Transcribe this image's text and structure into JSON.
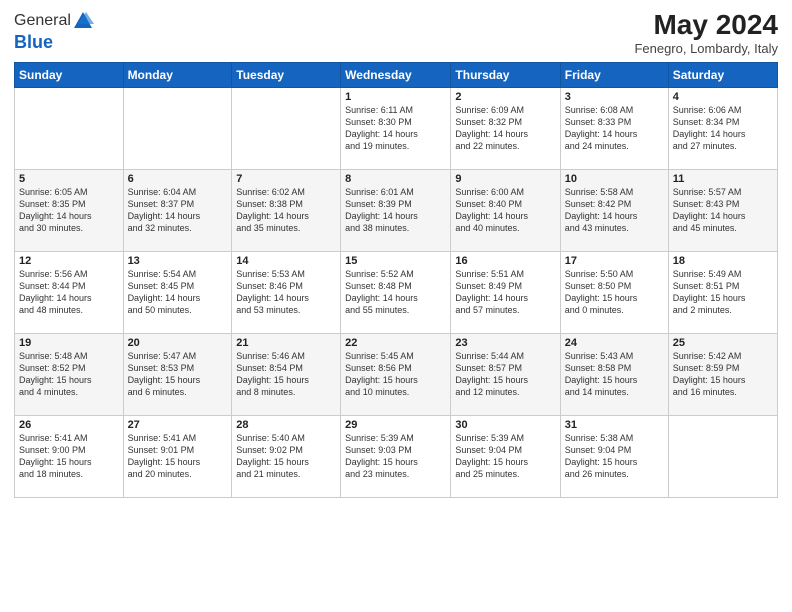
{
  "logo": {
    "general": "General",
    "blue": "Blue"
  },
  "header": {
    "month_year": "May 2024",
    "location": "Fenegro, Lombardy, Italy"
  },
  "weekdays": [
    "Sunday",
    "Monday",
    "Tuesday",
    "Wednesday",
    "Thursday",
    "Friday",
    "Saturday"
  ],
  "weeks": [
    [
      {
        "day": "",
        "info": ""
      },
      {
        "day": "",
        "info": ""
      },
      {
        "day": "",
        "info": ""
      },
      {
        "day": "1",
        "info": "Sunrise: 6:11 AM\nSunset: 8:30 PM\nDaylight: 14 hours\nand 19 minutes."
      },
      {
        "day": "2",
        "info": "Sunrise: 6:09 AM\nSunset: 8:32 PM\nDaylight: 14 hours\nand 22 minutes."
      },
      {
        "day": "3",
        "info": "Sunrise: 6:08 AM\nSunset: 8:33 PM\nDaylight: 14 hours\nand 24 minutes."
      },
      {
        "day": "4",
        "info": "Sunrise: 6:06 AM\nSunset: 8:34 PM\nDaylight: 14 hours\nand 27 minutes."
      }
    ],
    [
      {
        "day": "5",
        "info": "Sunrise: 6:05 AM\nSunset: 8:35 PM\nDaylight: 14 hours\nand 30 minutes."
      },
      {
        "day": "6",
        "info": "Sunrise: 6:04 AM\nSunset: 8:37 PM\nDaylight: 14 hours\nand 32 minutes."
      },
      {
        "day": "7",
        "info": "Sunrise: 6:02 AM\nSunset: 8:38 PM\nDaylight: 14 hours\nand 35 minutes."
      },
      {
        "day": "8",
        "info": "Sunrise: 6:01 AM\nSunset: 8:39 PM\nDaylight: 14 hours\nand 38 minutes."
      },
      {
        "day": "9",
        "info": "Sunrise: 6:00 AM\nSunset: 8:40 PM\nDaylight: 14 hours\nand 40 minutes."
      },
      {
        "day": "10",
        "info": "Sunrise: 5:58 AM\nSunset: 8:42 PM\nDaylight: 14 hours\nand 43 minutes."
      },
      {
        "day": "11",
        "info": "Sunrise: 5:57 AM\nSunset: 8:43 PM\nDaylight: 14 hours\nand 45 minutes."
      }
    ],
    [
      {
        "day": "12",
        "info": "Sunrise: 5:56 AM\nSunset: 8:44 PM\nDaylight: 14 hours\nand 48 minutes."
      },
      {
        "day": "13",
        "info": "Sunrise: 5:54 AM\nSunset: 8:45 PM\nDaylight: 14 hours\nand 50 minutes."
      },
      {
        "day": "14",
        "info": "Sunrise: 5:53 AM\nSunset: 8:46 PM\nDaylight: 14 hours\nand 53 minutes."
      },
      {
        "day": "15",
        "info": "Sunrise: 5:52 AM\nSunset: 8:48 PM\nDaylight: 14 hours\nand 55 minutes."
      },
      {
        "day": "16",
        "info": "Sunrise: 5:51 AM\nSunset: 8:49 PM\nDaylight: 14 hours\nand 57 minutes."
      },
      {
        "day": "17",
        "info": "Sunrise: 5:50 AM\nSunset: 8:50 PM\nDaylight: 15 hours\nand 0 minutes."
      },
      {
        "day": "18",
        "info": "Sunrise: 5:49 AM\nSunset: 8:51 PM\nDaylight: 15 hours\nand 2 minutes."
      }
    ],
    [
      {
        "day": "19",
        "info": "Sunrise: 5:48 AM\nSunset: 8:52 PM\nDaylight: 15 hours\nand 4 minutes."
      },
      {
        "day": "20",
        "info": "Sunrise: 5:47 AM\nSunset: 8:53 PM\nDaylight: 15 hours\nand 6 minutes."
      },
      {
        "day": "21",
        "info": "Sunrise: 5:46 AM\nSunset: 8:54 PM\nDaylight: 15 hours\nand 8 minutes."
      },
      {
        "day": "22",
        "info": "Sunrise: 5:45 AM\nSunset: 8:56 PM\nDaylight: 15 hours\nand 10 minutes."
      },
      {
        "day": "23",
        "info": "Sunrise: 5:44 AM\nSunset: 8:57 PM\nDaylight: 15 hours\nand 12 minutes."
      },
      {
        "day": "24",
        "info": "Sunrise: 5:43 AM\nSunset: 8:58 PM\nDaylight: 15 hours\nand 14 minutes."
      },
      {
        "day": "25",
        "info": "Sunrise: 5:42 AM\nSunset: 8:59 PM\nDaylight: 15 hours\nand 16 minutes."
      }
    ],
    [
      {
        "day": "26",
        "info": "Sunrise: 5:41 AM\nSunset: 9:00 PM\nDaylight: 15 hours\nand 18 minutes."
      },
      {
        "day": "27",
        "info": "Sunrise: 5:41 AM\nSunset: 9:01 PM\nDaylight: 15 hours\nand 20 minutes."
      },
      {
        "day": "28",
        "info": "Sunrise: 5:40 AM\nSunset: 9:02 PM\nDaylight: 15 hours\nand 21 minutes."
      },
      {
        "day": "29",
        "info": "Sunrise: 5:39 AM\nSunset: 9:03 PM\nDaylight: 15 hours\nand 23 minutes."
      },
      {
        "day": "30",
        "info": "Sunrise: 5:39 AM\nSunset: 9:04 PM\nDaylight: 15 hours\nand 25 minutes."
      },
      {
        "day": "31",
        "info": "Sunrise: 5:38 AM\nSunset: 9:04 PM\nDaylight: 15 hours\nand 26 minutes."
      },
      {
        "day": "",
        "info": ""
      }
    ]
  ]
}
